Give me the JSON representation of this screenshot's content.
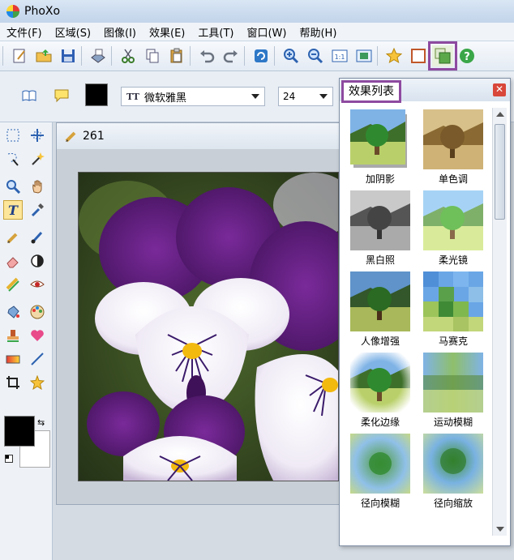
{
  "app": {
    "title": "PhoXo"
  },
  "menu": [
    "文件(F)",
    "区域(S)",
    "图像(I)",
    "效果(E)",
    "工具(T)",
    "窗口(W)",
    "帮助(H)"
  ],
  "options": {
    "font": "微软雅黑",
    "font_size": "24",
    "text_color": "#000000"
  },
  "document": {
    "name": "261"
  },
  "effects_panel": {
    "title": "效果列表",
    "items": [
      {
        "label": "加阴影"
      },
      {
        "label": "单色调"
      },
      {
        "label": "黑白照"
      },
      {
        "label": "柔光镜"
      },
      {
        "label": "人像增强"
      },
      {
        "label": "马赛克"
      },
      {
        "label": "柔化边缘"
      },
      {
        "label": "运动模糊"
      },
      {
        "label": "径向模糊"
      },
      {
        "label": "径向缩放"
      }
    ]
  },
  "colors": {
    "accent_highlight": "#8e4aa0",
    "foreground": "#000000",
    "background": "#ffffff"
  }
}
